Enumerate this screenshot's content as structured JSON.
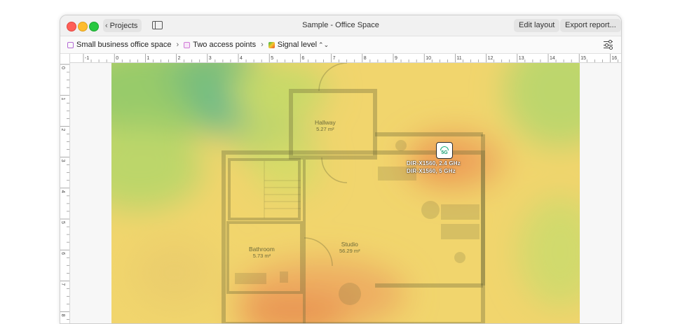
{
  "window": {
    "title": "Sample - Office Space",
    "projects_label": "Projects",
    "edit_layout_label": "Edit layout",
    "export_report_label": "Export report..."
  },
  "breadcrumb": {
    "items": [
      "Small business office space",
      "Two access points",
      "Signal level"
    ]
  },
  "ruler": {
    "h_ticks": [
      "-1",
      "0",
      "1",
      "2",
      "3",
      "4",
      "5",
      "6",
      "7",
      "8",
      "9",
      "10",
      "11",
      "12",
      "13",
      "14",
      "15",
      "16"
    ],
    "v_ticks": [
      "0",
      "1",
      "2",
      "3",
      "4",
      "5",
      "6",
      "7",
      "8"
    ]
  },
  "rooms": [
    {
      "name": "Hallway",
      "area": "5.27 m²"
    },
    {
      "name": "Studio",
      "area": "56.29 m²"
    },
    {
      "name": "Bathroom",
      "area": "5.73 m²"
    }
  ],
  "access_point": {
    "badge": "5G",
    "labels": [
      "DIR-X1560, 2.4 GHz",
      "DIR-X1560, 5 GHz"
    ]
  },
  "dimensions": [
    "285.0",
    "285.0",
    "123",
    "125.0",
    "450.0",
    "445",
    "400.0",
    "225.0",
    "229.0",
    "285.0",
    "285.0"
  ],
  "colors": {
    "accent_ap": "#1bb07a",
    "heat_low": "#6cc36a",
    "heat_mid": "#f4d36a",
    "heat_high": "#e78a4a"
  },
  "icons": [
    "chevron-left-icon",
    "sidebar-toggle-icon",
    "project-icon",
    "layout-icon",
    "signal-level-icon",
    "settings-sliders-icon",
    "wifi-icon"
  ]
}
